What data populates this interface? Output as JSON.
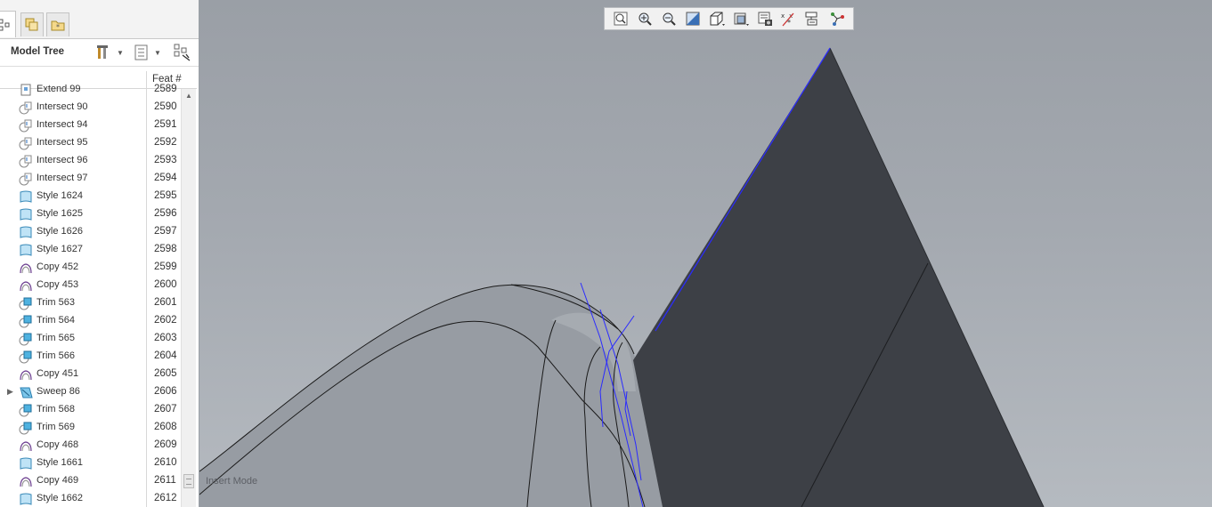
{
  "panel": {
    "title": "Model Tree",
    "column_header": "Feat #",
    "tabs": [
      "model-tree-tab",
      "layers-tab",
      "favorites-tab"
    ]
  },
  "tree": {
    "rows": [
      {
        "label": "Extend 99",
        "feat": "2589",
        "icon": "extend-icon"
      },
      {
        "label": "Intersect 90",
        "feat": "2590",
        "icon": "intersect-icon"
      },
      {
        "label": "Intersect 94",
        "feat": "2591",
        "icon": "intersect-icon"
      },
      {
        "label": "Intersect 95",
        "feat": "2592",
        "icon": "intersect-icon"
      },
      {
        "label": "Intersect 96",
        "feat": "2593",
        "icon": "intersect-icon"
      },
      {
        "label": "Intersect 97",
        "feat": "2594",
        "icon": "intersect-icon"
      },
      {
        "label": "Style 1624",
        "feat": "2595",
        "icon": "style-icon"
      },
      {
        "label": "Style 1625",
        "feat": "2596",
        "icon": "style-icon"
      },
      {
        "label": "Style 1626",
        "feat": "2597",
        "icon": "style-icon"
      },
      {
        "label": "Style 1627",
        "feat": "2598",
        "icon": "style-icon"
      },
      {
        "label": "Copy 452",
        "feat": "2599",
        "icon": "copy-icon"
      },
      {
        "label": "Copy 453",
        "feat": "2600",
        "icon": "copy-icon"
      },
      {
        "label": "Trim 563",
        "feat": "2601",
        "icon": "trim-icon"
      },
      {
        "label": "Trim 564",
        "feat": "2602",
        "icon": "trim-icon"
      },
      {
        "label": "Trim 565",
        "feat": "2603",
        "icon": "trim-icon"
      },
      {
        "label": "Trim 566",
        "feat": "2604",
        "icon": "trim-icon"
      },
      {
        "label": "Copy 451",
        "feat": "2605",
        "icon": "copy-icon"
      },
      {
        "label": "Sweep 86",
        "feat": "2606",
        "icon": "sweep-icon",
        "expandable": true
      },
      {
        "label": "Trim 568",
        "feat": "2607",
        "icon": "trim-icon"
      },
      {
        "label": "Trim 569",
        "feat": "2608",
        "icon": "trim-icon"
      },
      {
        "label": "Copy 468",
        "feat": "2609",
        "icon": "copy-icon"
      },
      {
        "label": "Style 1661",
        "feat": "2610",
        "icon": "style-icon"
      },
      {
        "label": "Copy 469",
        "feat": "2611",
        "icon": "copy-icon"
      },
      {
        "label": "Style 1662",
        "feat": "2612",
        "icon": "style-icon"
      }
    ]
  },
  "toolbar": {
    "buttons": [
      "refit-icon",
      "zoom-in-icon",
      "zoom-out-icon",
      "repaint-icon",
      "saved-orientations-icon",
      "display-style-icon",
      "view-manager-icon",
      "datum-display-icon",
      "annotation-display-icon",
      "spin-center-icon"
    ]
  },
  "viewport": {
    "status": "Insert Mode"
  },
  "colors": {
    "viewport_top": "#9a9fa6",
    "viewport_bottom": "#b5bac0",
    "dark_surface": "#3d4046",
    "highlight_edge": "#2a2aff"
  }
}
